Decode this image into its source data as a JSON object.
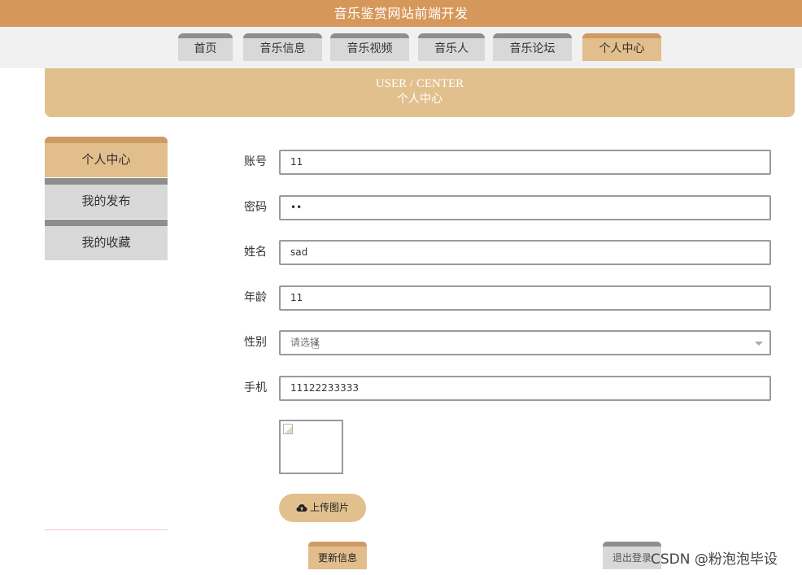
{
  "site_title": "音乐鉴赏网站前端开发",
  "nav": {
    "items": [
      {
        "label": "首页",
        "active": false
      },
      {
        "label": "音乐信息",
        "active": false
      },
      {
        "label": "音乐视频",
        "active": false
      },
      {
        "label": "音乐人",
        "active": false
      },
      {
        "label": "音乐论坛",
        "active": false
      },
      {
        "label": "个人中心",
        "active": true
      }
    ]
  },
  "banner": {
    "en": "USER / CENTER",
    "cn": "个人中心"
  },
  "sidebar": {
    "items": [
      {
        "label": "个人中心",
        "active": true
      },
      {
        "label": "我的发布",
        "active": false
      },
      {
        "label": "我的收藏",
        "active": false
      }
    ]
  },
  "form": {
    "account": {
      "label": "账号",
      "value": "11"
    },
    "password": {
      "label": "密码",
      "value": "••"
    },
    "name": {
      "label": "姓名",
      "value": "sad"
    },
    "age": {
      "label": "年龄",
      "value": "11"
    },
    "gender": {
      "label": "性别",
      "placeholder": "请选择"
    },
    "phone": {
      "label": "手机",
      "value": "11122233333"
    }
  },
  "buttons": {
    "upload": "上传图片",
    "update": "更新信息",
    "logout": "退出登录"
  },
  "watermark": "CSDN @粉泡泡毕设",
  "colors": {
    "accent": "#d6975a",
    "active_tab": "#e2be8c",
    "inactive_tab": "#d8d8d8"
  }
}
